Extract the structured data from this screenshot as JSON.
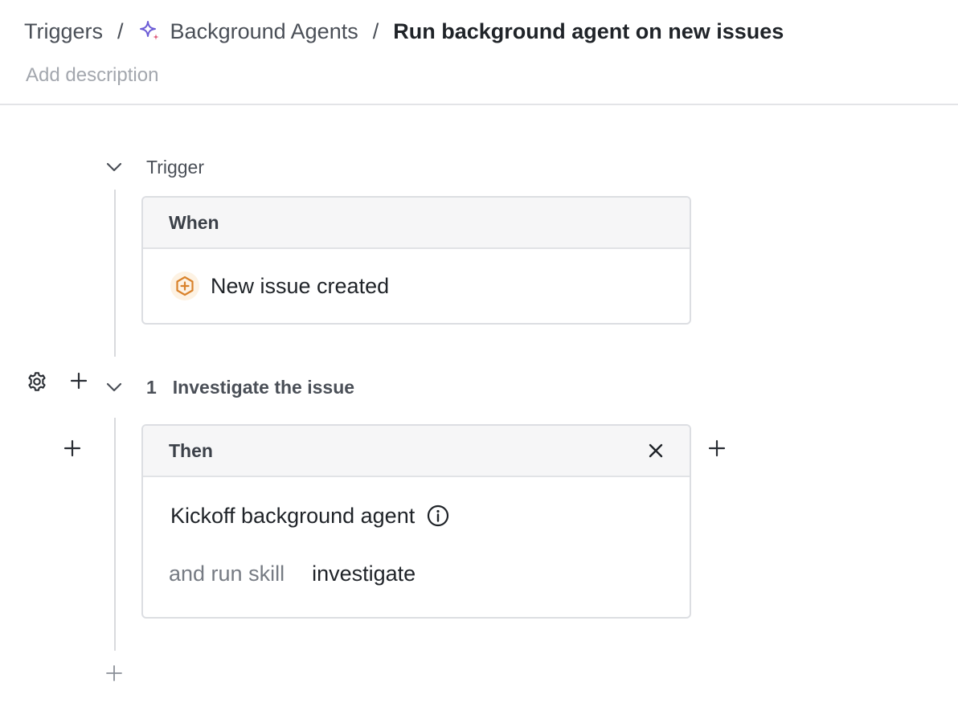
{
  "breadcrumb": {
    "root": "Triggers",
    "parent": "Background Agents",
    "current": "Run background agent on new issues",
    "separator": "/"
  },
  "description": {
    "placeholder": "Add description"
  },
  "trigger_section": {
    "title": "Trigger",
    "card_header": "When",
    "event_label": "New issue created",
    "event_icon": "plus-hexagon-icon"
  },
  "step": {
    "number": "1",
    "title": "Investigate the issue",
    "card_header": "Then",
    "action_label": "Kickoff background agent",
    "skill_prefix": "and run skill",
    "skill_value": "investigate"
  },
  "colors": {
    "accent_purple": "#6b5bd6",
    "accent_pink": "#e0607e",
    "trigger_orange": "#d9822b",
    "border": "#dcdee2",
    "header_bg": "#f6f6f7"
  }
}
